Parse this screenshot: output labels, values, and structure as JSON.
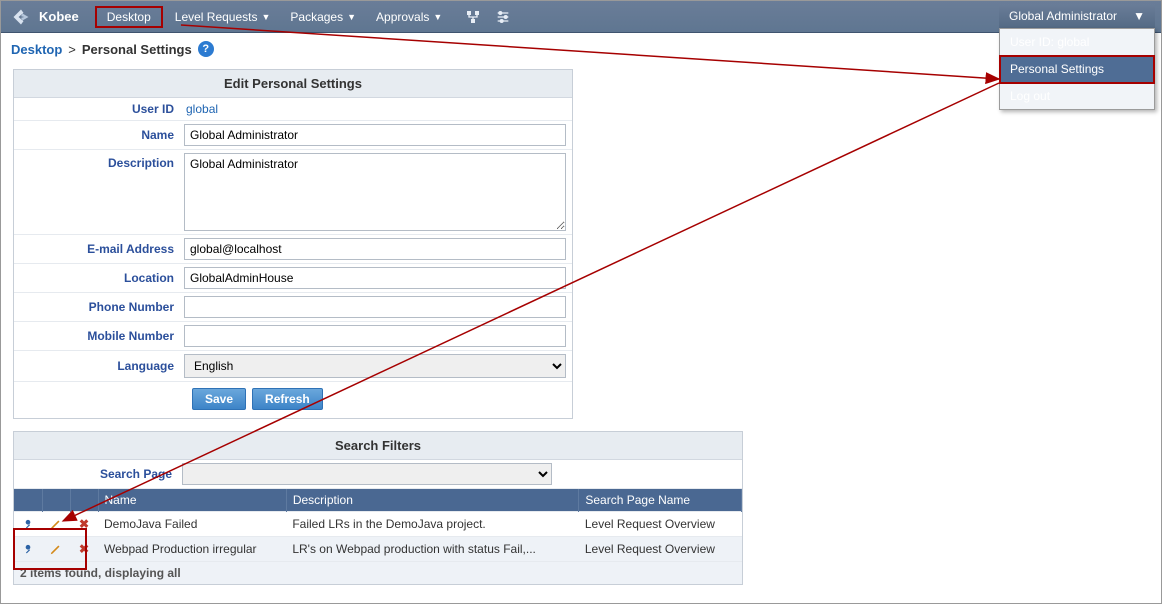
{
  "brand": "Kobee",
  "menu": {
    "desktop": "Desktop",
    "level_requests": "Level Requests",
    "packages": "Packages",
    "approvals": "Approvals"
  },
  "user_menu": {
    "label": "Global Administrator",
    "items": {
      "userid": "User ID: global",
      "personal": "Personal Settings",
      "logout": "Log out"
    }
  },
  "breadcrumb": {
    "root": "Desktop",
    "sep": ">",
    "current": "Personal Settings"
  },
  "edit_panel": {
    "title": "Edit Personal Settings",
    "fields": {
      "userid_label": "User ID",
      "userid_value": "global",
      "name_label": "Name",
      "name_value": "Global Administrator",
      "desc_label": "Description",
      "desc_value": "Global Administrator",
      "email_label": "E-mail Address",
      "email_value": "global@localhost",
      "location_label": "Location",
      "location_value": "GlobalAdminHouse",
      "phone_label": "Phone Number",
      "phone_value": "",
      "mobile_label": "Mobile Number",
      "mobile_value": "",
      "lang_label": "Language",
      "lang_value": "English"
    },
    "buttons": {
      "save": "Save",
      "refresh": "Refresh"
    }
  },
  "filters_panel": {
    "title": "Search Filters",
    "search_page_label": "Search Page",
    "columns": {
      "name": "Name",
      "desc": "Description",
      "spn": "Search Page Name"
    },
    "rows": [
      {
        "name": "DemoJava Failed",
        "desc": "Failed LRs in the DemoJava project.",
        "spn": "Level Request Overview"
      },
      {
        "name": "Webpad Production irregular",
        "desc": "LR's on Webpad production with status Fail,...",
        "spn": "Level Request Overview"
      }
    ],
    "footer": "2 items found, displaying all"
  }
}
